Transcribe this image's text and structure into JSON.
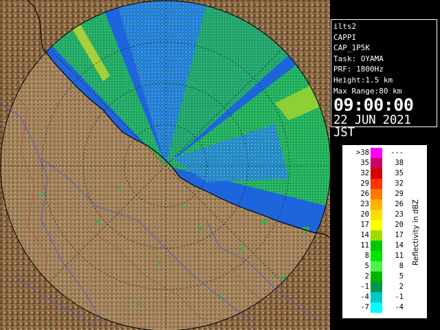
{
  "radar": {
    "info_lines": [
      "ilts2",
      "CAPPI",
      "CAP_1P5K",
      "Task: OYAMA",
      "PRF: 1800Hz",
      "Height:1.5 km",
      "Max Range:80 km"
    ],
    "time": "09:00:00",
    "date": "22 JUN 2021 JST"
  },
  "legend": {
    "title": "Reflectivity in dBZ",
    "rows": [
      {
        "lo": ">38",
        "hi": "---",
        "color": "#ff00ff"
      },
      {
        "lo": "35",
        "hi": "38",
        "color": "#c80064"
      },
      {
        "lo": "32",
        "hi": "35",
        "color": "#d20000"
      },
      {
        "lo": "29",
        "hi": "32",
        "color": "#ff3200"
      },
      {
        "lo": "26",
        "hi": "29",
        "color": "#ff7800"
      },
      {
        "lo": "23",
        "hi": "26",
        "color": "#ffb400"
      },
      {
        "lo": "20",
        "hi": "23",
        "color": "#ffdc00"
      },
      {
        "lo": "17",
        "hi": "20",
        "color": "#ffff00"
      },
      {
        "lo": "14",
        "hi": "17",
        "color": "#a0dc00"
      },
      {
        "lo": "11",
        "hi": "14",
        "color": "#00c800"
      },
      {
        "lo": "8",
        "hi": "11",
        "color": "#00e600"
      },
      {
        "lo": "5",
        "hi": "8",
        "color": "#50f050"
      },
      {
        "lo": "2",
        "hi": "5",
        "color": "#00b400"
      },
      {
        "lo": "-1",
        "hi": "2",
        "color": "#009650"
      },
      {
        "lo": "-4",
        "hi": "-1",
        "color": "#00c8c8"
      },
      {
        "lo": "-7",
        "hi": "-4",
        "color": "#00ffff"
      }
    ]
  },
  "colors": {
    "background": "#000000",
    "sea": "#1e64dc",
    "land": "#7a5a3a",
    "echo_weak": "#3cd2e6",
    "echo_mid": "#28c83c",
    "echo_strong": "#dcdc28"
  }
}
